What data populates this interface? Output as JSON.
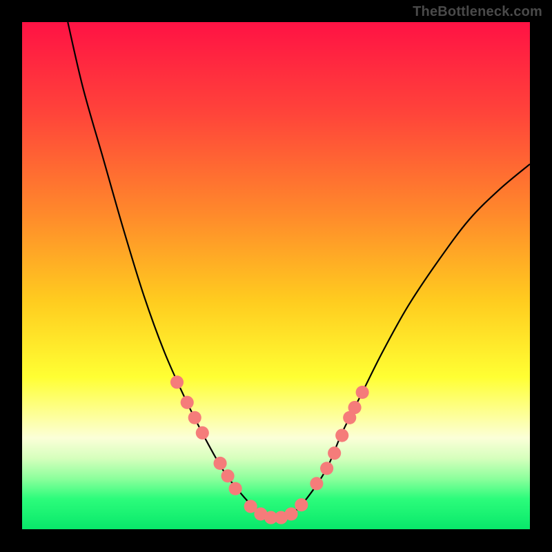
{
  "attribution": "TheBottleneck.com",
  "chart_data": {
    "type": "line",
    "title": "",
    "xlabel": "",
    "ylabel": "",
    "xlim": [
      0,
      100
    ],
    "ylim": [
      0,
      100
    ],
    "gradient_stops": [
      {
        "offset": 0,
        "color": "#ff1244"
      },
      {
        "offset": 18,
        "color": "#ff443a"
      },
      {
        "offset": 38,
        "color": "#ff8a2b"
      },
      {
        "offset": 55,
        "color": "#ffcc1f"
      },
      {
        "offset": 70,
        "color": "#ffff33"
      },
      {
        "offset": 78,
        "color": "#fdffa0"
      },
      {
        "offset": 82,
        "color": "#fbffd8"
      },
      {
        "offset": 86,
        "color": "#d6ffbd"
      },
      {
        "offset": 90,
        "color": "#8cff9c"
      },
      {
        "offset": 94,
        "color": "#2cfc7b"
      },
      {
        "offset": 100,
        "color": "#08e86a"
      }
    ],
    "series": [
      {
        "name": "bottleneck-curve",
        "x": [
          9,
          12,
          16,
          20,
          24,
          28,
          32,
          36,
          40,
          44,
          47,
          50,
          53,
          56,
          60,
          63,
          67,
          71,
          76,
          82,
          88,
          94,
          100
        ],
        "y": [
          100,
          87,
          73,
          59,
          46,
          35,
          26,
          18,
          11,
          6,
          3,
          2,
          3,
          6,
          12,
          19,
          27,
          35,
          44,
          53,
          61,
          67,
          72
        ]
      }
    ],
    "markers": [
      {
        "x": 30.5,
        "y": 29
      },
      {
        "x": 32.5,
        "y": 25
      },
      {
        "x": 34,
        "y": 22
      },
      {
        "x": 35.5,
        "y": 19
      },
      {
        "x": 39,
        "y": 13
      },
      {
        "x": 40.5,
        "y": 10.5
      },
      {
        "x": 42,
        "y": 8
      },
      {
        "x": 45,
        "y": 4.5
      },
      {
        "x": 47,
        "y": 3
      },
      {
        "x": 49,
        "y": 2.3
      },
      {
        "x": 51,
        "y": 2.3
      },
      {
        "x": 53,
        "y": 3
      },
      {
        "x": 55,
        "y": 4.8
      },
      {
        "x": 58,
        "y": 9
      },
      {
        "x": 60,
        "y": 12
      },
      {
        "x": 61.5,
        "y": 15
      },
      {
        "x": 63,
        "y": 18.5
      },
      {
        "x": 64.5,
        "y": 22
      },
      {
        "x": 65.5,
        "y": 24
      },
      {
        "x": 67,
        "y": 27
      }
    ],
    "marker_color": "#f57c7a",
    "marker_radius_percent": 1.3
  }
}
